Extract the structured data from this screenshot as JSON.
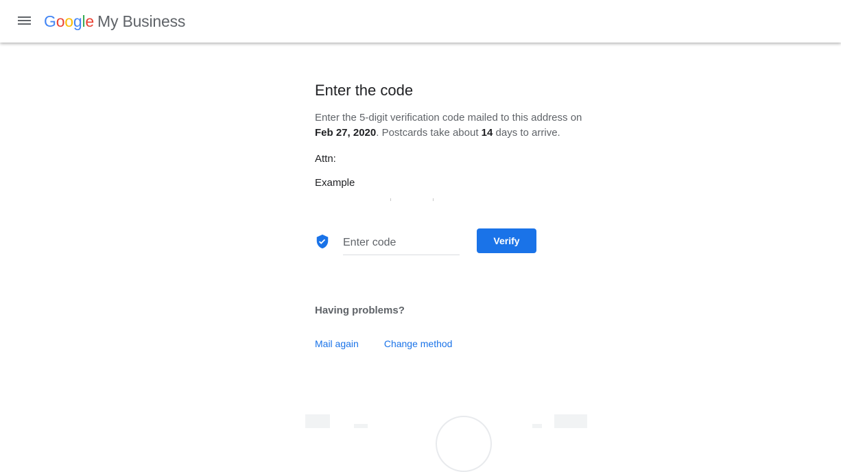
{
  "header": {
    "logo_letters": [
      "G",
      "o",
      "o",
      "g",
      "l",
      "e"
    ],
    "product_name": "My Business",
    "menu_icon": "hamburger-menu-icon"
  },
  "main": {
    "title": "Enter the code",
    "desc_prefix": "Enter the 5-digit verification code mailed to this address on",
    "mail_date": "Feb 27, 2020",
    "desc_middle": ". Postcards take about ",
    "days": "14",
    "desc_suffix": " days to arrive.",
    "attn_label": "Attn:",
    "business_name": "Example"
  },
  "verify": {
    "shield_icon": "verified-shield-icon",
    "input_placeholder": "Enter code",
    "input_value": "",
    "button_label": "Verify"
  },
  "help": {
    "heading": "Having problems?",
    "mail_again": "Mail again",
    "change_method": "Change method"
  },
  "colors": {
    "accent": "#1a73e8",
    "google_blue": "#4285f4",
    "google_red": "#ea4335",
    "google_yellow": "#fbbc05",
    "google_green": "#34a853",
    "muted_text": "#5f6368"
  }
}
